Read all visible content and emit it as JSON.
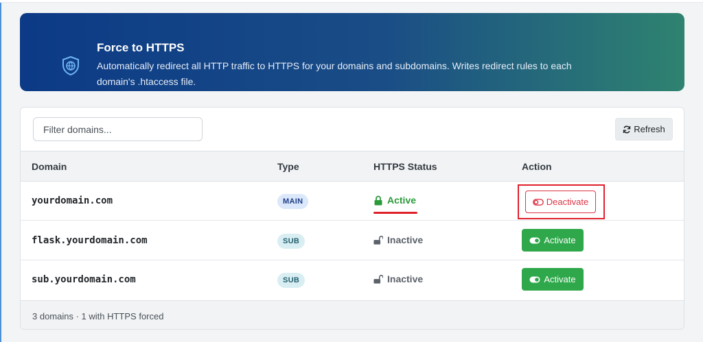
{
  "banner": {
    "title": "Force to HTTPS",
    "description": "Automatically redirect all HTTP traffic to HTTPS for your domains and subdomains. Writes redirect rules to each domain's .htaccess file.",
    "icon": "shield-globe-icon"
  },
  "toolbar": {
    "filter_placeholder": "Filter domains...",
    "filter_value": "",
    "refresh_label": "Refresh"
  },
  "table": {
    "headers": [
      "Domain",
      "Type",
      "HTTPS Status",
      "Action"
    ],
    "rows": [
      {
        "domain": "yourdomain.com",
        "type": "MAIN",
        "status": "Active",
        "action": "Deactivate"
      },
      {
        "domain": "flask.yourdomain.com",
        "type": "SUB",
        "status": "Inactive",
        "action": "Activate"
      },
      {
        "domain": "sub.yourdomain.com",
        "type": "SUB",
        "status": "Inactive",
        "action": "Activate"
      }
    ]
  },
  "footer": {
    "summary": "3 domains · 1 with HTTPS forced"
  },
  "colors": {
    "banner_start": "#0c3a86",
    "banner_end": "#2f8370",
    "active_green": "#2a9a3a",
    "activate_button": "#2ea84a",
    "deactivate_red": "#dc3545",
    "highlight_red": "#e01f2a"
  }
}
